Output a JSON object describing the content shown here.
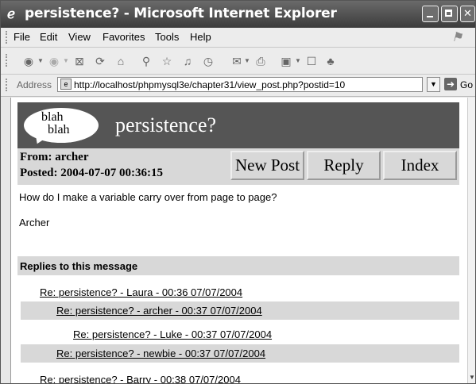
{
  "window": {
    "title": "persistence? - Microsoft Internet Explorer",
    "icon": "ie-logo-icon"
  },
  "menubar": {
    "items": [
      "File",
      "Edit",
      "View",
      "Favorites",
      "Tools",
      "Help"
    ]
  },
  "toolbar": {
    "icons": [
      "back-icon",
      "forward-icon",
      "stop-icon",
      "refresh-icon",
      "home-icon",
      "search-icon",
      "favorites-icon",
      "media-icon",
      "history-icon",
      "mail-icon",
      "print-icon",
      "edit-icon",
      "discuss-icon",
      "messenger-icon"
    ]
  },
  "addressbar": {
    "label": "Address",
    "url": "http://localhost/phpmysql3e/chapter31/view_post.php?postid=10",
    "go_label": "Go"
  },
  "page": {
    "logo_line1": "blah",
    "logo_line2": "blah",
    "title": "persistence?",
    "from": "From: archer",
    "posted": "Posted: 2004-07-07 00:36:15",
    "buttons": {
      "new_post": "New Post",
      "reply": "Reply",
      "index": "Index"
    },
    "message": "How do I make a variable carry over from page to page?",
    "signature": "Archer",
    "replies_header": "Replies to this message",
    "replies": [
      {
        "text": "Re: persistence? - Laura - 00:36 07/07/2004",
        "level": 1,
        "shaded": false
      },
      {
        "text": "Re: persistence? - archer - 00:37 07/07/2004",
        "level": 2,
        "shaded": true
      },
      {
        "text": "Re: persistence? - Luke - 00:37 07/07/2004",
        "level": 3,
        "shaded": false
      },
      {
        "text": "Re: persistence? - newbie - 00:37 07/07/2004",
        "level": 2,
        "shaded": true
      },
      {
        "text": "Re: persistence? - Barry - 00:38 07/07/2004",
        "level": 1,
        "shaded": false
      }
    ]
  }
}
